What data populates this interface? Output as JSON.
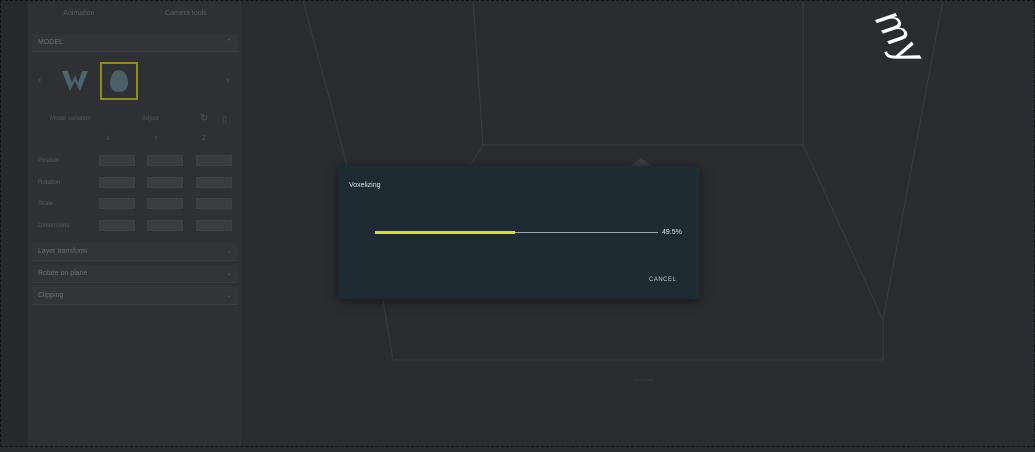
{
  "sidebar": {
    "tabs": [
      "Animation",
      "Camera tools"
    ],
    "model_section": "MODEL",
    "model_row": [
      "Model variation",
      "Adjust"
    ],
    "axes": [
      "X",
      "Y",
      "Z"
    ],
    "properties": [
      "Position",
      "Rotation",
      "Scale",
      "Dimensions"
    ],
    "sections": [
      "Layer transform",
      "Rotate on plane",
      "Clipping"
    ]
  },
  "dialog": {
    "title": "Voxelizing",
    "progress": 0.495,
    "progress_text": "49.5%",
    "cancel_label": "CANCEL",
    "accent_color": "#d8de18",
    "background_color": "#1f2b33"
  },
  "watermark": "my"
}
